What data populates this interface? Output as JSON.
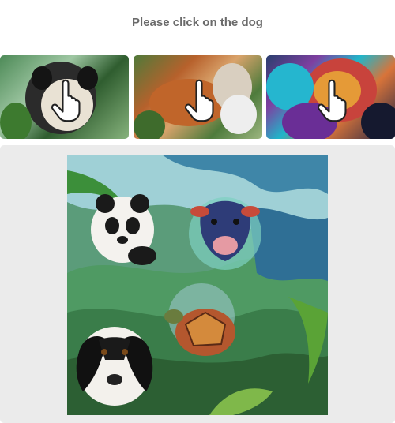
{
  "prompt": {
    "text": "Please click on the dog"
  },
  "examples": [
    {
      "subject": "dog"
    },
    {
      "subject": "dog"
    },
    {
      "subject": "dog"
    }
  ],
  "puzzle": {
    "animals": [
      "panda",
      "cow",
      "turtle",
      "dog"
    ]
  },
  "icons": {
    "pointer": "hand-pointer-icon"
  }
}
